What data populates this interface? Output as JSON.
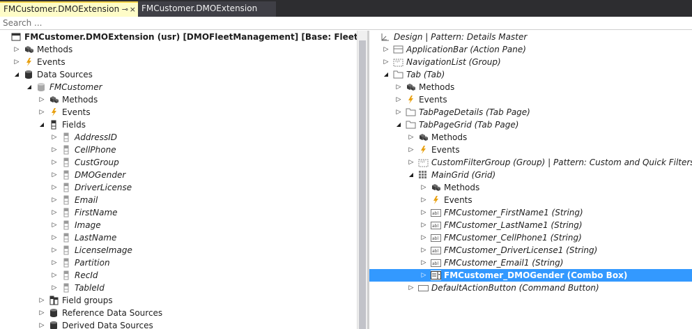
{
  "tabs": [
    {
      "label": "FMCustomer.DMOExtension",
      "active": true,
      "pin": "⊸",
      "close": "×"
    },
    {
      "label": "FMCustomer.DMOExtension",
      "active": false
    }
  ],
  "search": {
    "placeholder": "Search ...",
    "value": ""
  },
  "left_tree": [
    {
      "label": "FMCustomer.DMOExtension (usr) [DMOFleetManagement] [Base: Fleet Management]",
      "level": 0,
      "arrow": "none",
      "icon": "window-icon",
      "style": "bold"
    },
    {
      "label": "Methods",
      "level": 1,
      "arrow": "collapsed",
      "icon": "methods-icon",
      "style": "normal"
    },
    {
      "label": "Events",
      "level": 1,
      "arrow": "collapsed",
      "icon": "lightning-icon",
      "style": "normal"
    },
    {
      "label": "Data Sources",
      "level": 1,
      "arrow": "expanded",
      "icon": "database-icon",
      "style": "normal"
    },
    {
      "label": "FMCustomer",
      "level": 2,
      "arrow": "expanded",
      "icon": "database-icon-gray",
      "style": "italic"
    },
    {
      "label": "Methods",
      "level": 3,
      "arrow": "collapsed",
      "icon": "methods-icon",
      "style": "normal"
    },
    {
      "label": "Events",
      "level": 3,
      "arrow": "collapsed",
      "icon": "lightning-icon",
      "style": "normal"
    },
    {
      "label": "Fields",
      "level": 3,
      "arrow": "expanded",
      "icon": "field-icon",
      "style": "normal"
    },
    {
      "label": "AddressID",
      "level": 4,
      "arrow": "collapsed",
      "icon": "field-icon-gray",
      "style": "italic"
    },
    {
      "label": "CellPhone",
      "level": 4,
      "arrow": "collapsed",
      "icon": "field-icon-gray",
      "style": "italic"
    },
    {
      "label": "CustGroup",
      "level": 4,
      "arrow": "collapsed",
      "icon": "field-icon-gray",
      "style": "italic"
    },
    {
      "label": "DMOGender",
      "level": 4,
      "arrow": "collapsed",
      "icon": "field-icon-gray",
      "style": "italic"
    },
    {
      "label": "DriverLicense",
      "level": 4,
      "arrow": "collapsed",
      "icon": "field-icon-gray",
      "style": "italic"
    },
    {
      "label": "Email",
      "level": 4,
      "arrow": "collapsed",
      "icon": "field-icon-gray",
      "style": "italic"
    },
    {
      "label": "FirstName",
      "level": 4,
      "arrow": "collapsed",
      "icon": "field-icon-gray",
      "style": "italic"
    },
    {
      "label": "Image",
      "level": 4,
      "arrow": "collapsed",
      "icon": "field-icon-gray",
      "style": "italic"
    },
    {
      "label": "LastName",
      "level": 4,
      "arrow": "collapsed",
      "icon": "field-icon-gray",
      "style": "italic"
    },
    {
      "label": "LicenseImage",
      "level": 4,
      "arrow": "collapsed",
      "icon": "field-icon-gray",
      "style": "italic"
    },
    {
      "label": "Partition",
      "level": 4,
      "arrow": "collapsed",
      "icon": "field-icon-gray",
      "style": "italic"
    },
    {
      "label": "RecId",
      "level": 4,
      "arrow": "collapsed",
      "icon": "field-icon-gray",
      "style": "italic"
    },
    {
      "label": "TableId",
      "level": 4,
      "arrow": "collapsed",
      "icon": "field-icon-gray",
      "style": "italic"
    },
    {
      "label": "Field groups",
      "level": 3,
      "arrow": "collapsed",
      "icon": "field-groups-icon",
      "style": "normal"
    },
    {
      "label": "Reference Data Sources",
      "level": 3,
      "arrow": "collapsed",
      "icon": "database-icon",
      "style": "normal"
    },
    {
      "label": "Derived Data Sources",
      "level": 3,
      "arrow": "collapsed",
      "icon": "database-icon",
      "style": "normal"
    }
  ],
  "right_tree": [
    {
      "label": "Design | Pattern: Details Master",
      "level": 0,
      "arrow": "none",
      "icon": "design-icon",
      "style": "italic"
    },
    {
      "label": "ApplicationBar (Action Pane)",
      "level": 1,
      "arrow": "collapsed",
      "icon": "action-pane-icon",
      "style": "italic"
    },
    {
      "label": "NavigationList (Group)",
      "level": 1,
      "arrow": "collapsed",
      "icon": "group-icon",
      "style": "italic"
    },
    {
      "label": "Tab (Tab)",
      "level": 1,
      "arrow": "expanded",
      "icon": "tab-icon",
      "style": "italic"
    },
    {
      "label": "Methods",
      "level": 2,
      "arrow": "collapsed",
      "icon": "methods-icon",
      "style": "normal"
    },
    {
      "label": "Events",
      "level": 2,
      "arrow": "collapsed",
      "icon": "lightning-icon",
      "style": "normal"
    },
    {
      "label": "TabPageDetails (Tab Page)",
      "level": 2,
      "arrow": "collapsed",
      "icon": "tab-page-icon",
      "style": "italic"
    },
    {
      "label": "TabPageGrid (Tab Page)",
      "level": 2,
      "arrow": "expanded",
      "icon": "tab-page-icon",
      "style": "italic"
    },
    {
      "label": "Methods",
      "level": 3,
      "arrow": "collapsed",
      "icon": "methods-icon",
      "style": "normal"
    },
    {
      "label": "Events",
      "level": 3,
      "arrow": "collapsed",
      "icon": "lightning-icon",
      "style": "normal"
    },
    {
      "label": "CustomFilterGroup (Group) | Pattern: Custom and Quick Filters",
      "level": 3,
      "arrow": "collapsed",
      "icon": "group-icon",
      "style": "italic"
    },
    {
      "label": "MainGrid (Grid)",
      "level": 3,
      "arrow": "expanded",
      "icon": "grid-icon",
      "style": "italic"
    },
    {
      "label": "Methods",
      "level": 4,
      "arrow": "collapsed",
      "icon": "methods-icon",
      "style": "normal"
    },
    {
      "label": "Events",
      "level": 4,
      "arrow": "collapsed",
      "icon": "lightning-icon",
      "style": "normal"
    },
    {
      "label": "FMCustomer_FirstName1 (String)",
      "level": 4,
      "arrow": "collapsed",
      "icon": "string-icon",
      "style": "italic"
    },
    {
      "label": "FMCustomer_LastName1 (String)",
      "level": 4,
      "arrow": "collapsed",
      "icon": "string-icon",
      "style": "italic"
    },
    {
      "label": "FMCustomer_CellPhone1 (String)",
      "level": 4,
      "arrow": "collapsed",
      "icon": "string-icon",
      "style": "italic"
    },
    {
      "label": "FMCustomer_DriverLicense1 (String)",
      "level": 4,
      "arrow": "collapsed",
      "icon": "string-icon",
      "style": "italic"
    },
    {
      "label": "FMCustomer_Email1 (String)",
      "level": 4,
      "arrow": "collapsed",
      "icon": "string-icon",
      "style": "italic"
    },
    {
      "label": "FMCustomer_DMOGender (Combo Box)",
      "level": 4,
      "arrow": "collapsed",
      "icon": "combo-box-icon",
      "style": "bold",
      "selected": true
    },
    {
      "label": "DefaultActionButton (Command Button)",
      "level": 3,
      "arrow": "collapsed",
      "icon": "command-button-icon",
      "style": "italic"
    }
  ],
  "glyphs": {
    "collapsed": "▷",
    "expanded": "◢",
    "string_icon_text": "abl",
    "lightning_color": "#e8a010",
    "selection_color": "#3399ff"
  }
}
